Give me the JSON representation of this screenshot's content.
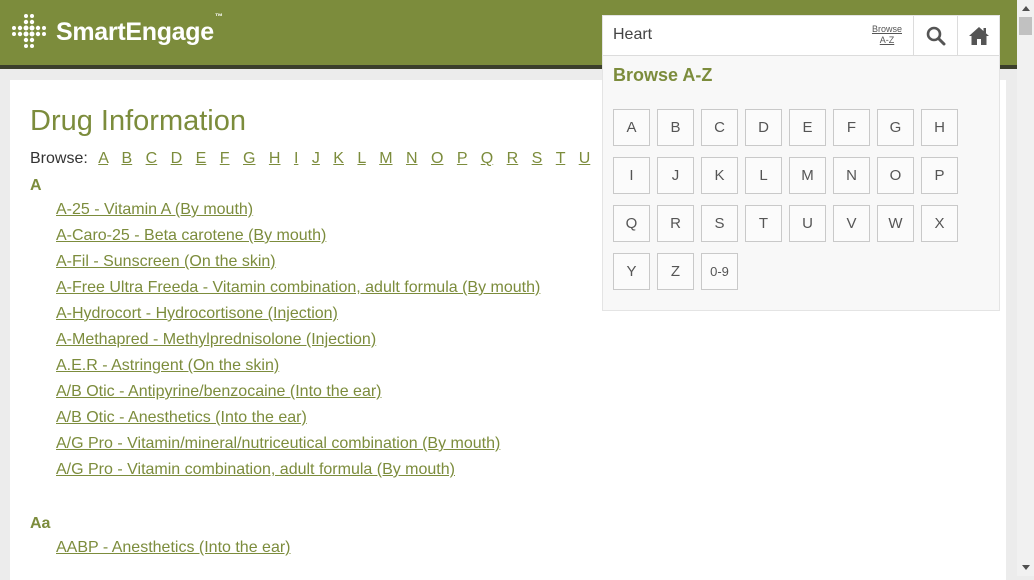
{
  "header": {
    "brand": "SmartEngage",
    "trademark": "™"
  },
  "page": {
    "title": "Drug Information",
    "browse_label": "Browse:",
    "browse_letters": [
      "A",
      "B",
      "C",
      "D",
      "E",
      "F",
      "G",
      "H",
      "I",
      "J",
      "K",
      "L",
      "M",
      "N",
      "O",
      "P",
      "Q",
      "R",
      "S",
      "T",
      "U"
    ]
  },
  "sections": [
    {
      "heading": "A",
      "items": [
        "A-25 - Vitamin A (By mouth)",
        "A-Caro-25 - Beta carotene (By mouth)",
        "A-Fil - Sunscreen (On the skin)",
        "A-Free Ultra Freeda - Vitamin combination, adult formula (By mouth)",
        "A-Hydrocort - Hydrocortisone (Injection)",
        "A-Methapred - Methylprednisolone (Injection)",
        "A.E.R - Astringent (On the skin)",
        "A/B Otic - Antipyrine/benzocaine (Into the ear)",
        "A/B Otic - Anesthetics (Into the ear)",
        "A/G Pro - Vitamin/mineral/nutriceutical combination (By mouth)",
        "A/G Pro - Vitamin combination, adult formula (By mouth)"
      ]
    },
    {
      "heading": "Aa",
      "items": [
        "AABP - Anesthetics (Into the ear)"
      ]
    }
  ],
  "dropdown": {
    "search_value": "Heart",
    "browse_az_line1": "Browse",
    "browse_az_line2": "A-Z",
    "title": "Browse A-Z",
    "letters": [
      "A",
      "B",
      "C",
      "D",
      "E",
      "F",
      "G",
      "H",
      "I",
      "J",
      "K",
      "L",
      "M",
      "N",
      "O",
      "P",
      "Q",
      "R",
      "S",
      "T",
      "U",
      "V",
      "W",
      "X",
      "Y",
      "Z",
      "0-9"
    ]
  },
  "icons": {
    "search": "search-icon",
    "home": "home-icon",
    "logo": "logo-cross-icon"
  },
  "colors": {
    "brand_green": "#7c8c3c",
    "header_rule": "#3b3f2c"
  }
}
